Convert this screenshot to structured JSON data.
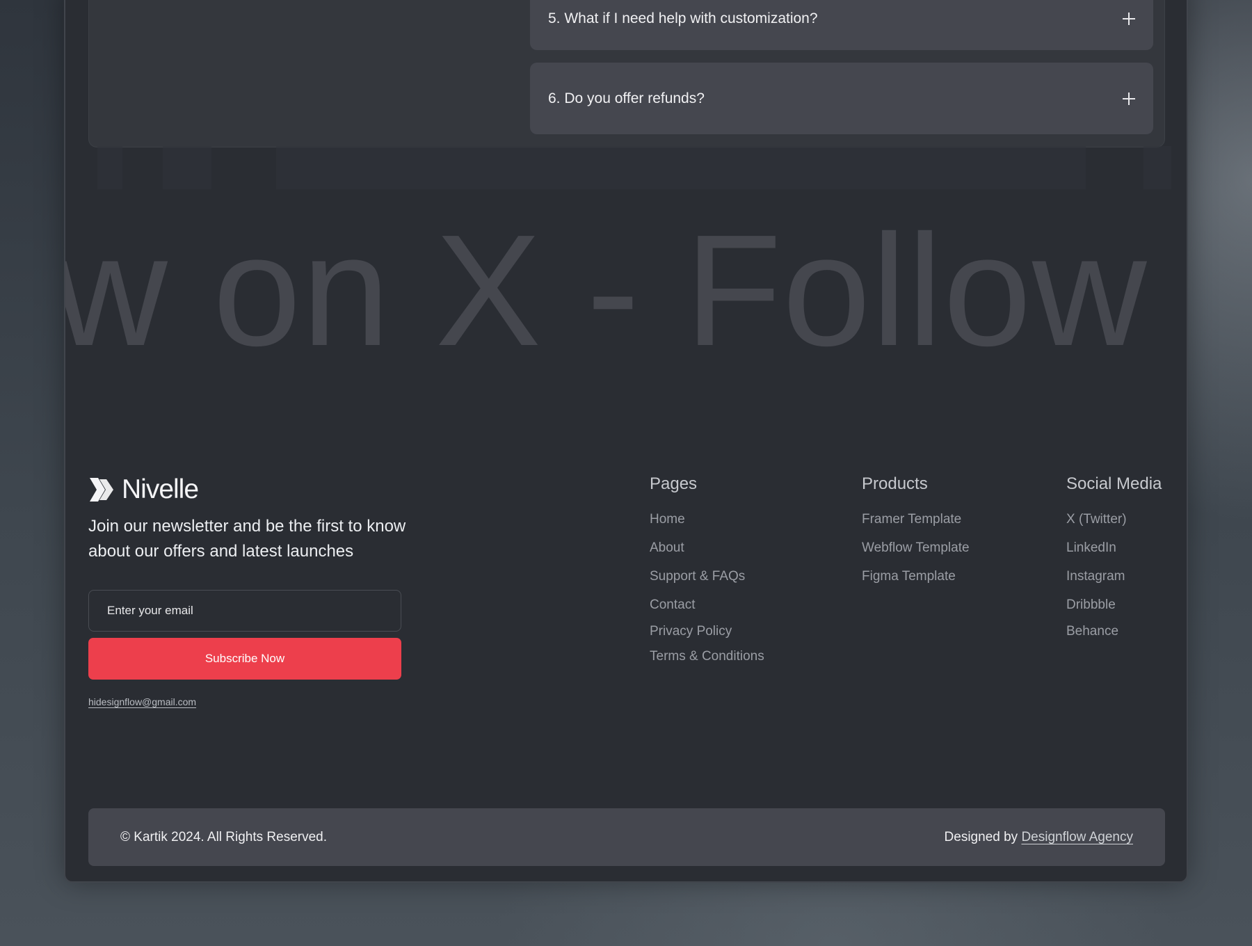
{
  "faq": {
    "items": [
      {
        "question": "5. What if I need help with customization?"
      },
      {
        "question": "6. Do you offer refunds?"
      }
    ]
  },
  "marquee": {
    "text": "w on X - Follow o"
  },
  "brand": {
    "name": "Nivelle"
  },
  "newsletter": {
    "text": "Join our newsletter and be the first to know about our offers and latest launches",
    "email_placeholder": "Enter your email",
    "subscribe_label": "Subscribe Now",
    "contact_email": "hidesignflow@gmail.com"
  },
  "footer": {
    "pages": {
      "heading": "Pages",
      "links": [
        "Home",
        "About",
        "Support & FAQs",
        "Contact",
        "Privacy Policy",
        "Terms & Conditions"
      ]
    },
    "products": {
      "heading": "Products",
      "links": [
        "Framer Template",
        "Webflow Template",
        "Figma Template"
      ]
    },
    "social": {
      "heading": "Social Media",
      "links": [
        "X (Twitter)",
        "LinkedIn",
        "Instagram",
        "Dribbble",
        "Behance"
      ]
    }
  },
  "bottom_bar": {
    "copyright": "© Kartik 2024. All Rights Reserved.",
    "designed_by": "Designed by",
    "agency": "Designflow Agency"
  },
  "colors": {
    "accent": "#ed3f4c",
    "panel": "#2a2d33",
    "card": "#45474f"
  },
  "icons": {
    "faq_toggle": "plus-icon",
    "logo": "nivelle-logo-icon"
  }
}
